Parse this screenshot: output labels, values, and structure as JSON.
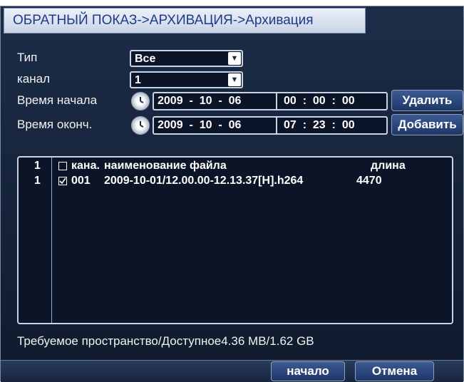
{
  "window": {
    "title": "ОБРАТНЫЙ ПОКАЗ->АРХИВАЦИЯ->Архивация"
  },
  "form": {
    "type_label": "Тип",
    "type_value": "Все",
    "channel_label": "канал",
    "channel_value": "1",
    "start_label": "Время начала",
    "start_date": "2009  -  10  -  06",
    "start_time": "00  :  00  :  00",
    "end_label": "Время оконч.",
    "end_date": "2009  -  10  -  06",
    "end_time": "07  :  23  :  00"
  },
  "buttons": {
    "delete": "Удалить",
    "add": "Добавить",
    "start": "начало",
    "cancel": "Отмена"
  },
  "list": {
    "headers": {
      "index": "1",
      "channel": "кана.",
      "filename": "наименование файла",
      "length": "длина"
    },
    "rows": [
      {
        "index": "1",
        "checked": true,
        "channel": "001",
        "filename": "2009-10-01/12.00.00-12.13.37[H].h264",
        "length": "4470"
      }
    ]
  },
  "status": {
    "space": "Требуемое пространство/Доступное4.36 MB/1.62 GB"
  },
  "icons": {
    "clock": "clock-icon",
    "dropdown": "chevron-down-icon",
    "checkbox": "checkbox-icon"
  },
  "colors": {
    "background": "#13203a",
    "title_text": "#1f3a86",
    "border": "#c9d3e6"
  }
}
